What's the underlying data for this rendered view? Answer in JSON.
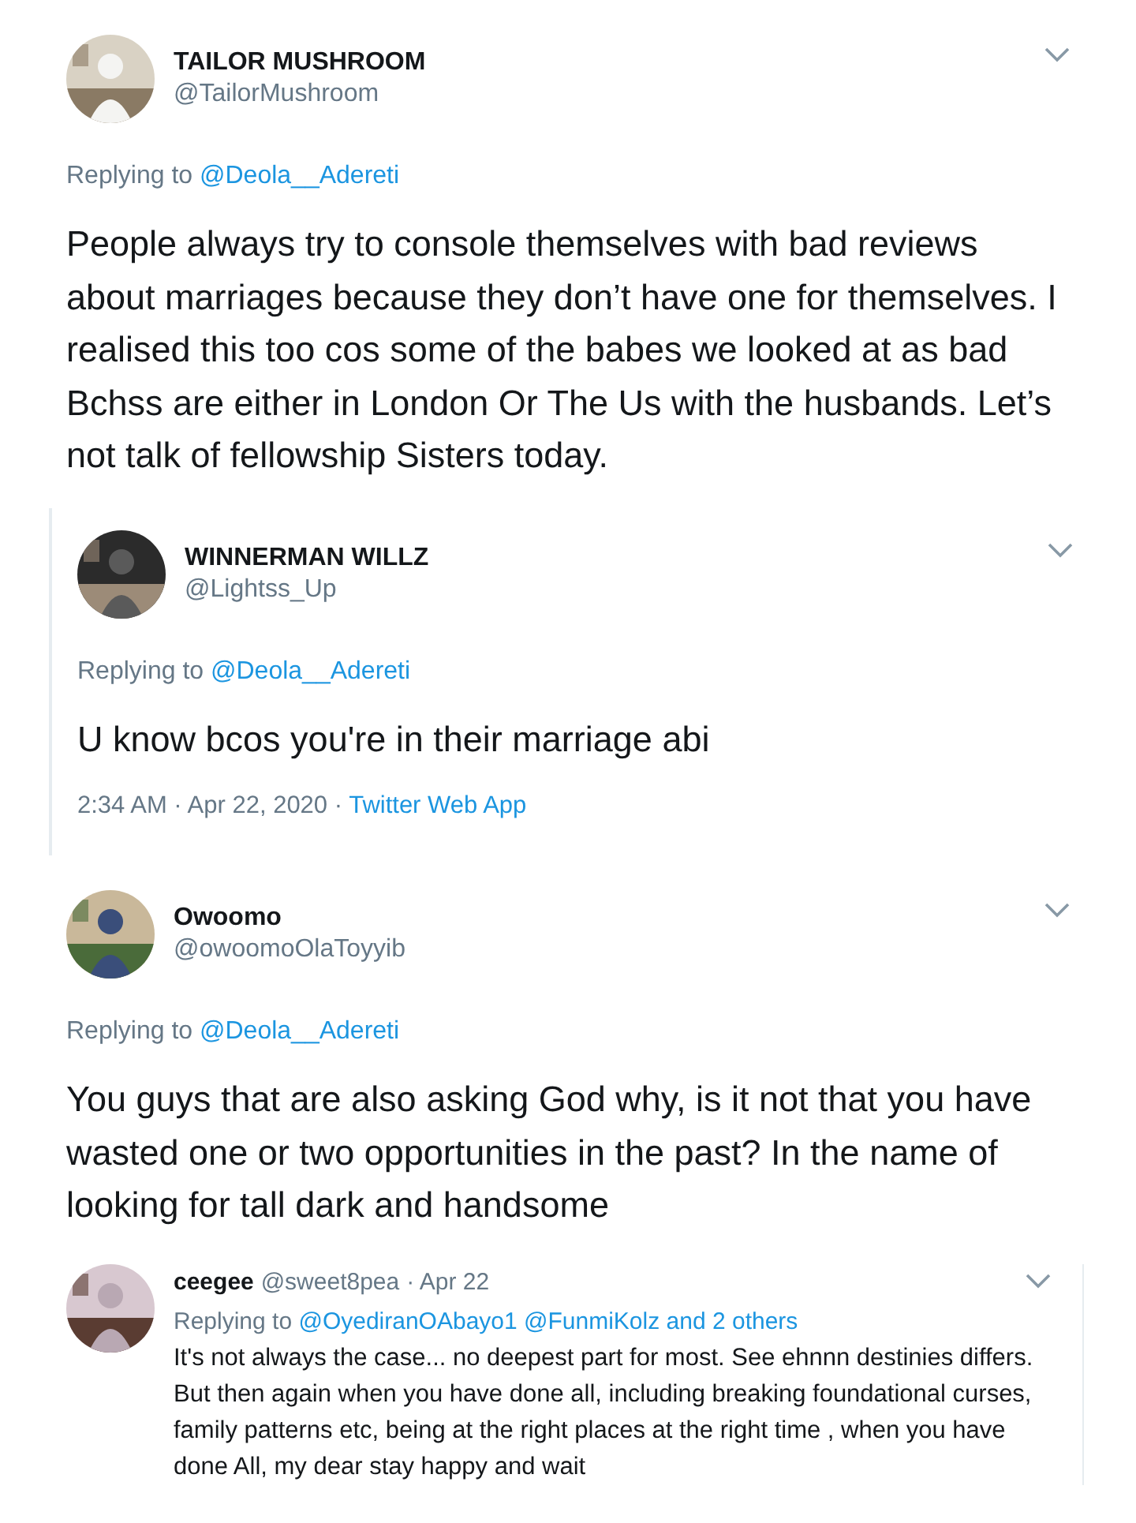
{
  "tweets": [
    {
      "kind": "main",
      "name": "TAILOR MUSHROOM",
      "handle": "@TailorMushroom",
      "replying_label": "Replying to",
      "replying_to": "@Deola__Adereti",
      "text": "People always try to console themselves with bad reviews about marriages because they don’t have one for themselves. I realised this too cos some of the babes we looked at as bad Bchss are either in London Or The Us with the husbands. Let’s not talk of fellowship Sisters today."
    },
    {
      "kind": "quoted",
      "name": "WINNERMAN WILLZ",
      "handle": "@Lightss_Up",
      "replying_label": "Replying to",
      "replying_to": "@Deola__Adereti",
      "text": "U know bcos you're in their marriage abi",
      "time": "2:34 AM · Apr 22, 2020",
      "dot": "·",
      "source": "Twitter Web App"
    },
    {
      "kind": "main",
      "name": "Owoomo",
      "handle": "@owoomoOlaToyyib",
      "replying_label": "Replying to",
      "replying_to": "@Deola__Adereti",
      "text": "You guys that are also asking God why, is it not that you have wasted one or two opportunities in the past? In the name of looking for tall dark and handsome"
    },
    {
      "kind": "compact",
      "name": "ceegee",
      "handle": "@sweet8pea",
      "date": "· Apr 22",
      "replying_label": "Replying to",
      "replying_to": "@OyediranOAbayo1 @FunmiKolz and 2 others",
      "text": "It's not always the case... no deepest part for most. See ehnnn destinies differs. But then again when you have done all, including breaking foundational curses, family patterns etc, being at the right places at the right time , when you have done All, my dear stay happy and wait"
    }
  ]
}
